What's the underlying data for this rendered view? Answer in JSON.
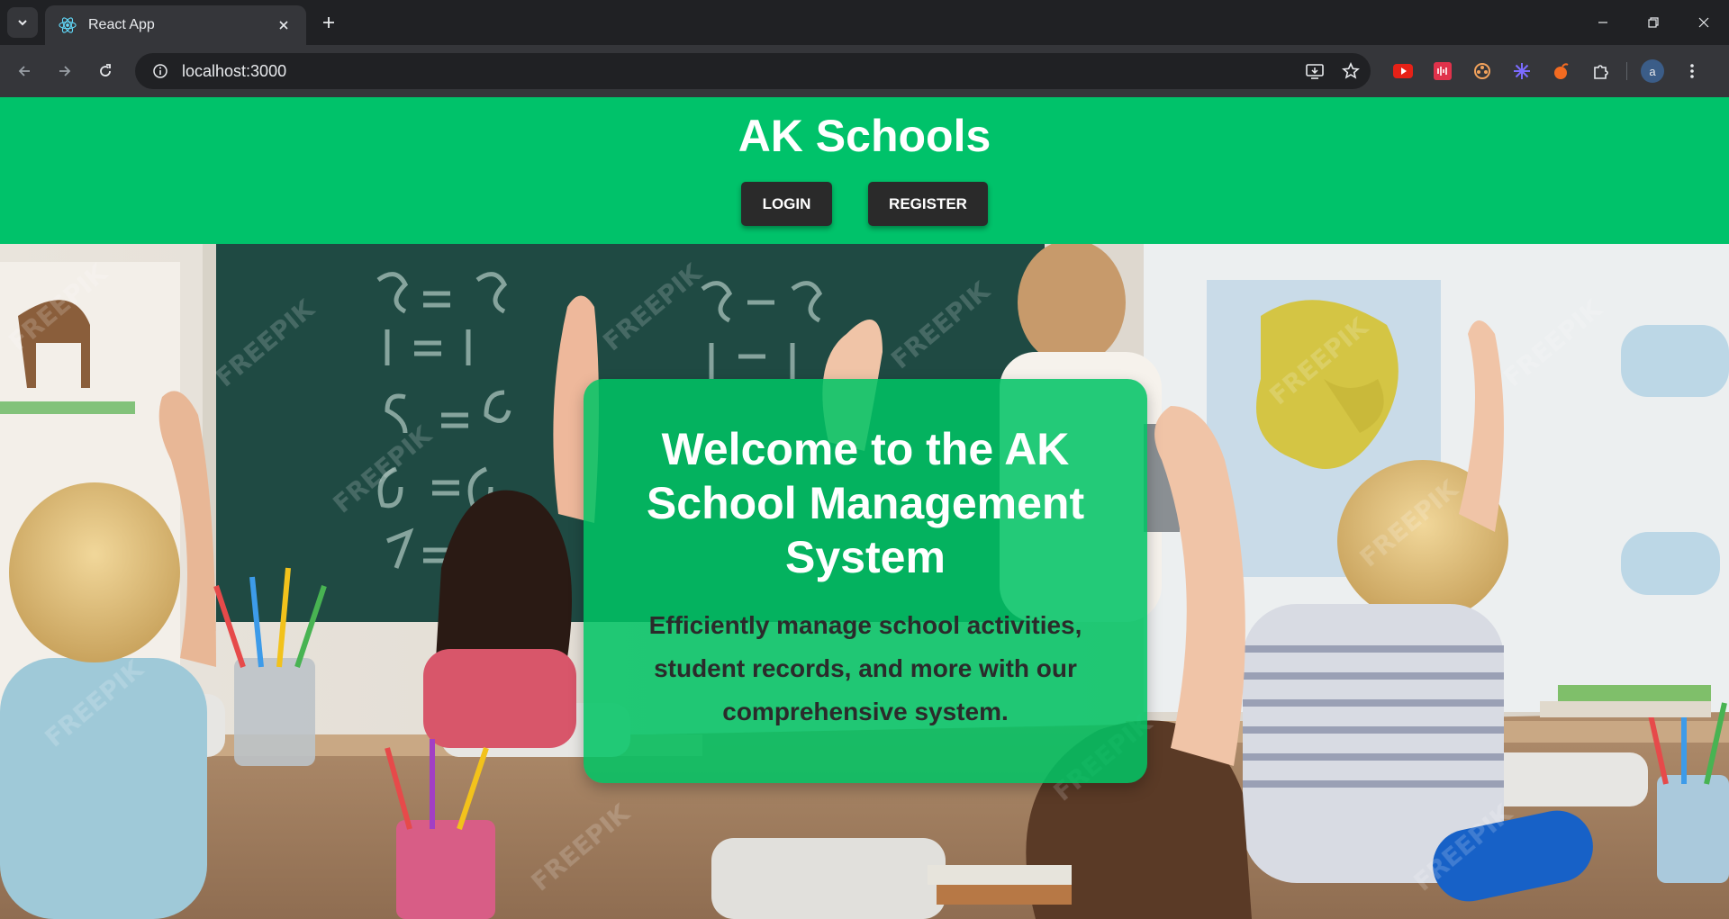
{
  "browser": {
    "tab": {
      "title": "React App",
      "favicon": "react-icon"
    },
    "address_bar": {
      "url": "localhost:3000"
    },
    "profile_initial": "a",
    "extensions": [
      "youtube-icon",
      "podcast-icon",
      "film-reel-icon",
      "sparkle-icon",
      "fruit-icon",
      "puzzle-icon"
    ]
  },
  "header": {
    "title": "AK Schools",
    "login_label": "LOGIN",
    "register_label": "REGISTER"
  },
  "hero": {
    "welcome_title": "Welcome to the AK School Management System",
    "welcome_text": "Efficiently manage school activities, student records, and more with our comprehensive system.",
    "background": "classroom-photo"
  },
  "colors": {
    "header_green": "#00c26a",
    "button_dark": "#2a2a2a",
    "card_green": "#00c464"
  }
}
